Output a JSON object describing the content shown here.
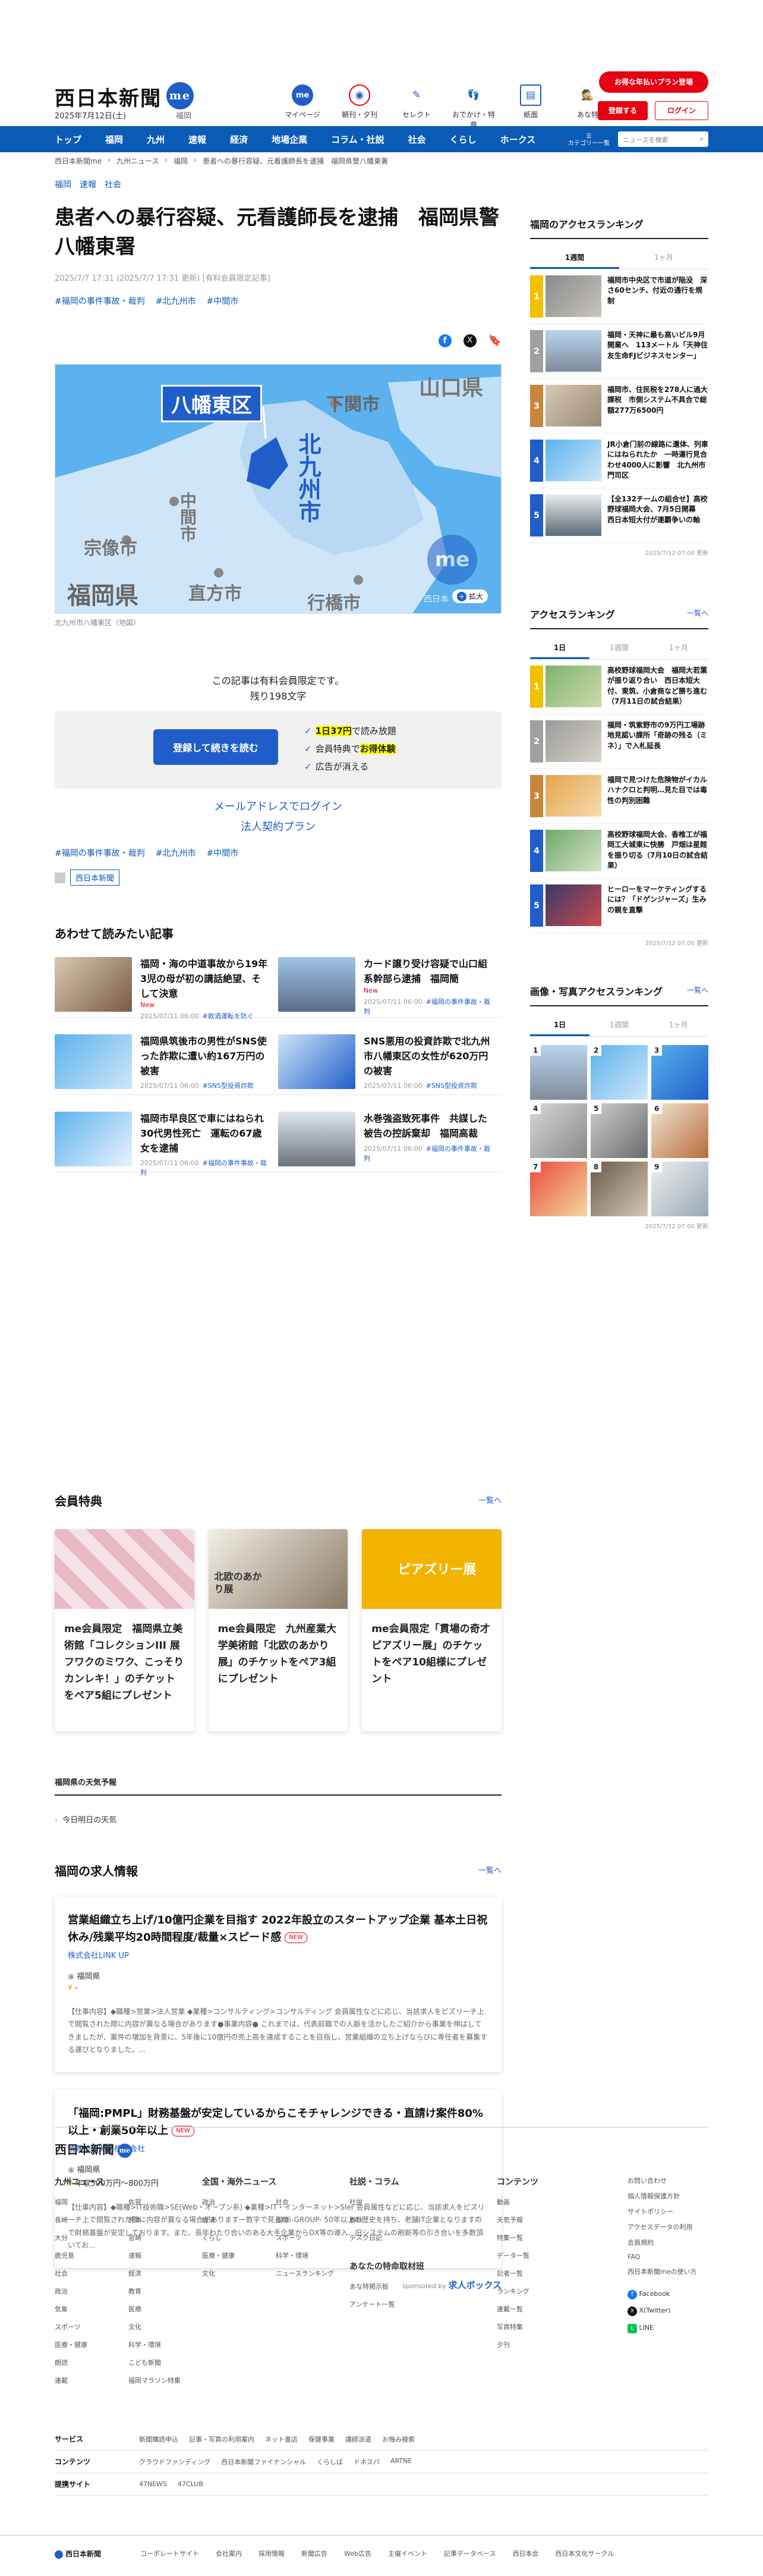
{
  "header": {
    "logo": "西日本新聞",
    "logo_badge": "me",
    "date": "2025年7月12日(土)",
    "region": "福岡",
    "icons": [
      {
        "label": "マイページ",
        "icon": "me-icon"
      },
      {
        "label": "朝刊・夕刊",
        "icon": "newspaper-icon"
      },
      {
        "label": "セレクト",
        "icon": "select-icon"
      },
      {
        "label": "おでかけ・特典",
        "icon": "footprint-icon"
      },
      {
        "label": "紙面",
        "icon": "paper-icon"
      },
      {
        "label": "あな特",
        "icon": "detective-icon"
      }
    ],
    "plan_button": "お得な年払いプラン登場",
    "register_button": "登録する",
    "login_button": "ログイン"
  },
  "nav": {
    "items": [
      "トップ",
      "福岡",
      "九州",
      "速報",
      "経済",
      "地場企業",
      "コラム・社説",
      "社会",
      "くらし",
      "ホークス"
    ],
    "category_label": "カテゴリー一覧",
    "search_placeholder": "ニュースを検索"
  },
  "breadcrumb": [
    "西日本新聞me",
    "九州ニュース",
    "福岡",
    "患者への暴行容疑、元看護師長を逮捕　福岡県警八幡東署"
  ],
  "article": {
    "tags": [
      "福岡",
      "速報",
      "社会"
    ],
    "title": "患者への暴行容疑、元看護師長を逮捕　福岡県警八幡東署",
    "meta": "2025/7/7 17:31 (2025/7/7 17:31 更新) [有料会員限定記事]",
    "topic_tags": [
      "#福岡の事件事故・裁判",
      "#北九州市",
      "#中間市"
    ],
    "map": {
      "label": "八幡東区",
      "places": [
        "下関市",
        "山口県",
        "中間市",
        "北九州市",
        "宗像市",
        "直方市",
        "行橋市",
        "福岡県"
      ],
      "zoom_label": "拡大",
      "watermark": "西日本"
    },
    "caption": "北九州市八幡東区（地図）",
    "paywall_line1": "この記事は有料会員限定です。",
    "paywall_line2": "残り198文字",
    "register_continue": "登録して続きを読む",
    "perks": [
      {
        "pre": "",
        "hl": "1日37円",
        "post": "で読み放題"
      },
      {
        "pre": "会員特典で",
        "hl": "お得体験",
        "post": ""
      },
      {
        "pre": "広告が消える",
        "hl": "",
        "post": ""
      }
    ],
    "mail_login": "メールアドレスでログイン",
    "corporate": "法人契約プラン",
    "publisher": "西日本新聞"
  },
  "related": {
    "heading": "あわせて読みたい記事",
    "items": [
      {
        "title": "福岡・海の中道事故から19年　3児の母が初の講話絶望、そして決意",
        "badge": "New",
        "date": "2025/07/11 06:00",
        "tag": "#飲酒運転を防ぐ"
      },
      {
        "title": "カード譲り受け容疑で山口組系幹部ら逮捕　福岡簡",
        "badge": "New",
        "date": "2025/07/11 06:00",
        "tag": "#福岡の事件事故・裁判"
      },
      {
        "title": "福岡県筑後市の男性がSNS使った詐欺に遭い約167万円の被害",
        "badge": "",
        "date": "2025/07/11 06:00",
        "tag": "#SNS型投資詐欺"
      },
      {
        "title": "SNS悪用の投資詐欺で北九州市八幡東区の女性が620万円の被害",
        "badge": "",
        "date": "2025/07/11 06:00",
        "tag": "#SNS型投資詐欺"
      },
      {
        "title": "福岡市早良区で車にはねられ30代男性死亡　運転の67歳女を逮捕",
        "badge": "",
        "date": "2025/07/11 06:00",
        "tag": "#福岡の事件事故・裁判"
      },
      {
        "title": "水巻強盗致死事件　共謀した被告の控訴棄却　福岡高裁",
        "badge": "",
        "date": "2025/07/11 06:00",
        "tag": "#福岡の事件事故・裁判"
      }
    ]
  },
  "members": {
    "heading": "会員特典",
    "more": "一覧へ",
    "cards": [
      {
        "text": "me会員限定　福岡県立美術館「コレクションIII 展 フワクのミワク、こっそりカンレキ！」のチケットをペア5組にプレゼント"
      },
      {
        "text": "me会員限定　九州産業大学美術館「北欧のあかり展」のチケットをペア3組にプレゼント"
      },
      {
        "text": "me会員限定「貫場の奇才 ピアズリー展」のチケットをペア10組様にプレゼント"
      }
    ],
    "card_labels": [
      "",
      "北欧のあかり展",
      "ピアズリー展"
    ]
  },
  "weather": {
    "heading": "福岡県の天気予報",
    "item": "今日明日の天気"
  },
  "jobs": {
    "heading": "福岡の求人情報",
    "more": "一覧へ",
    "items": [
      {
        "title": "営業組織立ち上げ/10億円企業を目指す 2022年設立のスタートアップ企業 基本土日祝休み/残業平均20時間程度/裁量×スピード感",
        "badge": "NEW",
        "company": "株式会社LINK UP",
        "location": "福岡県",
        "salary": "-",
        "desc": "【仕事内容】◆職種>営業>法人営業 ◆業種>コンサルティング>コンサルティング 会員属性などに応じ、当該求人をピズリーチ上で閲覧された際に内容が異なる場合があります●事業内容● これまでは、代表前職での人脈を活かしたご紹介から事業を伸ばしてきましたが、案件の増加を背景に、5年後に10億円の売上高を達成することを目指し、営業組織の立ち上げならびに専任者を募集する運びとなりました。..."
      },
      {
        "title": "「福岡:PMPL」財務基盤が安定しているからこそチャレンジできる・直請け案件80%以上・創業50年以上",
        "badge": "NEW",
        "company": "情報技術開発株式会社",
        "location": "福岡県",
        "salary": "年収500万円〜800万円",
        "desc": "【仕事内容】◆職種>IT技術職>SE(Web・オープン系) ◆業種>IT・インターネット>SIer 会員属性などに応じ、当該求人をピズリーチ上で閲覧された際に内容が異なる場合があります一数字で見るtdi-GROUP- 50年以上の歴史を持ち、老舗IT企業となりますので財務基盤が安定しております。また、長年わたり合いのある大手企業からDX等の導入、旧システムの刷新等の引き合いを多数頂いてお..."
      }
    ],
    "sponsor": "sponsored by",
    "sponsor_name": "求人ボックス"
  },
  "sidebar": {
    "local_ranking": {
      "heading": "福岡のアクセスランキング",
      "tabs": [
        "1週間",
        "1ヶ月"
      ],
      "items": [
        "福岡市中央区で市道が陥没　深さ60センチ、付近の通行を規制",
        "福岡・天神に最も高いビル9月開業へ　113メートル「天神住友生命FJビジネスセンター」",
        "福岡市、住民税を278人に過大課税　市側システム不具合で総額277万6500円",
        "JR小倉门前の線路に遺体、列車にはねられたか　一時運行見合わせ4000人に影響　北九州市門司区",
        "【全132チームの組合せ】高校野球福岡大会、7月5日開幕　西日本短大付が連覇争いの軸"
      ],
      "date": "2025/7/12 07:00 更新"
    },
    "access_ranking": {
      "heading": "アクセスランキング",
      "more": "一覧へ",
      "tabs": [
        "1日",
        "1週間",
        "1ヶ月"
      ],
      "items": [
        "高校野球福岡大会　福岡大若葉が振り返り合い　西日本短大付、東筑、小倉商など勝ち進む（7月11日の試合結果）",
        "福岡・筑紫野市の9万円工場跡地見認い課所「奇跡の残る（ミネ）」で入札延長",
        "福岡で見つけた危険物がイカルハナクロと判明…見た目では毒性の判別困難",
        "高校野球福岡大会、香椎工が福岡工大城東に快勝　戸畑は星館を振り切る（7月10日の試合結果）",
        "ヒーローをマーケティングするには？「ドゲンジャーズ」生みの親を直撃"
      ],
      "date": "2025/7/12 07:00 更新"
    },
    "photo_ranking": {
      "heading": "画像・写真アクセスランキング",
      "more": "一覧へ",
      "tabs": [
        "1日",
        "1週間",
        "1ヶ月"
      ],
      "date": "2025/7/12 07:00 更新"
    }
  },
  "footer": {
    "logo": "西日本新聞",
    "columns": [
      {
        "heading": "九州ニュース",
        "links": [
          "福岡",
          "佐賀",
          "長崎",
          "熊本",
          "大分",
          "宮崎",
          "鹿児島",
          "速報",
          "社会",
          "経済",
          "政治",
          "教育",
          "気象",
          "医療",
          "スポーツ",
          "文化",
          "医療・健康",
          "科学・環境",
          "朗読",
          "こども新聞",
          "連載",
          "福岡マラソン特集"
        ]
      },
      {
        "heading": "全国・海外ニュース",
        "links": [
          "政治",
          "社会",
          "経済",
          "国際",
          "くらし",
          "スポーツ",
          "医療・健康",
          "科学・環境",
          "文化",
          "ニュースランキング"
        ]
      },
      {
        "heading": "社説・コラム",
        "links": [
          "社説",
          "春秋",
          "デスク日記"
        ]
      },
      {
        "heading": "コンテンツ",
        "links": [
          "動画",
          "天気予報",
          "特集一覧",
          "データ一覧",
          "記者一覧",
          "ランキング",
          "連載一覧",
          "写真特集",
          "夕刊"
        ]
      }
    ],
    "special_heading": "あなたの特命取材班",
    "special_links": [
      "あな特掲示板",
      "アンケート一覧"
    ],
    "side_links": [
      "お問い合わせ",
      "個人情報保護方針",
      "サイトポリシー",
      "アクセスデータの利用",
      "会員規約",
      "FAQ",
      "西日本新聞meの使い方"
    ],
    "social": [
      "Facebook",
      "X(Twitter)",
      "LINE"
    ],
    "rows": [
      {
        "label": "サービス",
        "links": [
          "新聞購読申込",
          "記事・写真の利用案内",
          "ネット書店",
          "保健事業",
          "講師派遣",
          "お悔み検索"
        ]
      },
      {
        "label": "コンテンツ",
        "links": [
          "クラウドファンディング",
          "西日本新聞ファイナンシャル",
          "くらしば",
          "ドネスパ",
          "ARTNE"
        ]
      },
      {
        "label": "提携サイト",
        "links": [
          "47NEWS",
          "47CLUB"
        ]
      }
    ],
    "bottom_links": [
      "コーポレートサイト",
      "会社案内",
      "採用情報",
      "新聞広告",
      "Web広告",
      "主催イベント",
      "記事データベース",
      "西日本会",
      "西日本文化サークル"
    ]
  }
}
